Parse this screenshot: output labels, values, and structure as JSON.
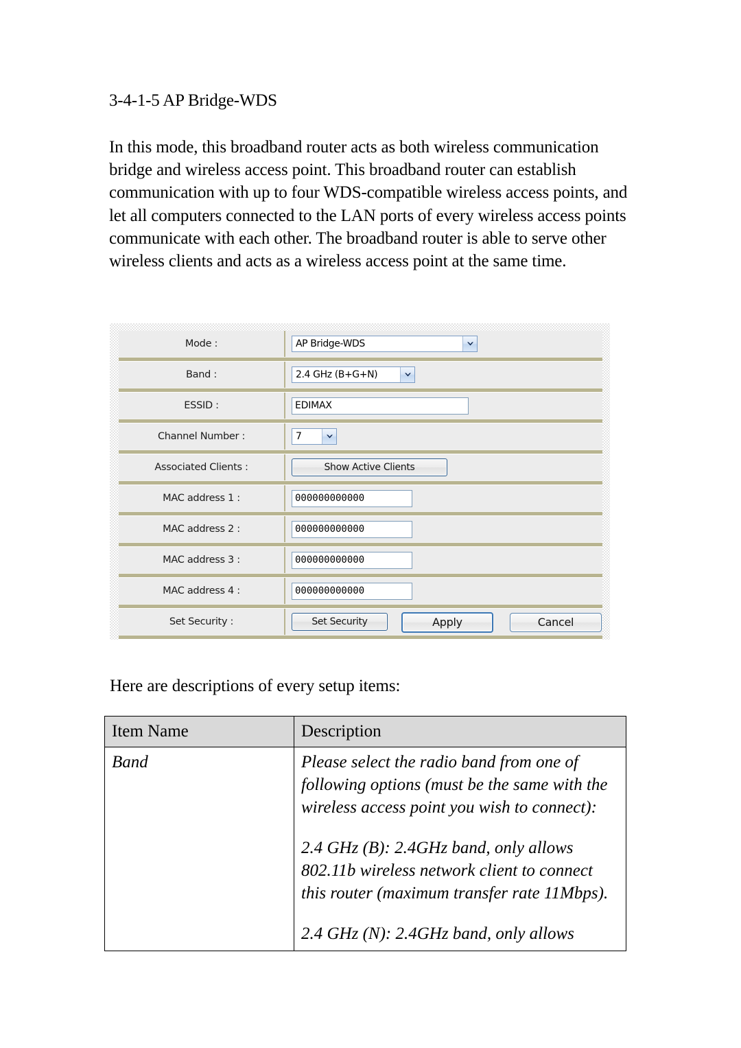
{
  "document": {
    "heading": "3-4-1-5 AP Bridge-WDS",
    "intro_paragraph": "In this mode, this broadband router acts as both wireless communication bridge and wireless access point. This broadband router can establish communication with up to four WDS-compatible wireless access points, and let all computers connected to the LAN ports of every wireless access points communicate with each other. The broadband router is able to serve other wireless clients and acts as a wireless access point at the same time.",
    "sub_paragraph": "Here are descriptions of every setup items:"
  },
  "config_panel": {
    "rows": [
      {
        "label": "Mode :",
        "control": "select",
        "value": "AP Bridge-WDS"
      },
      {
        "label": "Band :",
        "control": "select",
        "value": "2.4 GHz (B+G+N)"
      },
      {
        "label": "ESSID :",
        "control": "text",
        "value": "EDIMAX"
      },
      {
        "label": "Channel Number :",
        "control": "select",
        "value": "7"
      },
      {
        "label": "Associated Clients :",
        "control": "button",
        "value": "Show Active Clients"
      },
      {
        "label": "MAC address 1 :",
        "control": "text",
        "value": "000000000000"
      },
      {
        "label": "MAC address 2 :",
        "control": "text",
        "value": "000000000000"
      },
      {
        "label": "MAC address 3 :",
        "control": "text",
        "value": "000000000000"
      },
      {
        "label": "MAC address 4 :",
        "control": "text",
        "value": "000000000000"
      },
      {
        "label": "Set Security :",
        "control": "button",
        "value": "Set Security"
      }
    ],
    "mode_label": "Mode :",
    "mode_value": "AP Bridge-WDS",
    "band_label": "Band :",
    "band_value": "2.4 GHz (B+G+N)",
    "essid_label": "ESSID :",
    "essid_value": "EDIMAX",
    "channel_label": "Channel Number :",
    "channel_value": "7",
    "assoc_label": "Associated Clients :",
    "assoc_button": "Show Active Clients",
    "mac1_label": "MAC address 1 :",
    "mac1_value": "000000000000",
    "mac2_label": "MAC address 2 :",
    "mac2_value": "000000000000",
    "mac3_label": "MAC address 3 :",
    "mac3_value": "000000000000",
    "mac4_label": "MAC address 4 :",
    "mac4_value": "000000000000",
    "security_label": "Set Security :",
    "security_button": "Set Security",
    "apply_label": "Apply",
    "cancel_label": "Cancel",
    "colors": {
      "row_background": "#ececec",
      "row_separator": "#b8b490",
      "input_border": "#7f9db9",
      "focus_border": "#3c77b4"
    }
  },
  "description_table": {
    "headers": [
      "Item Name",
      "Description"
    ],
    "rows": [
      {
        "item": "Band",
        "description_paragraphs": [
          "Please select the radio band from one of following options (must be the same with the wireless access point you wish to connect):",
          "2.4 GHz (B): 2.4GHz band, only allows 802.11b wireless network client to connect this router (maximum transfer rate 11Mbps).",
          "2.4 GHz (N): 2.4GHz band, only allows"
        ]
      }
    ]
  }
}
